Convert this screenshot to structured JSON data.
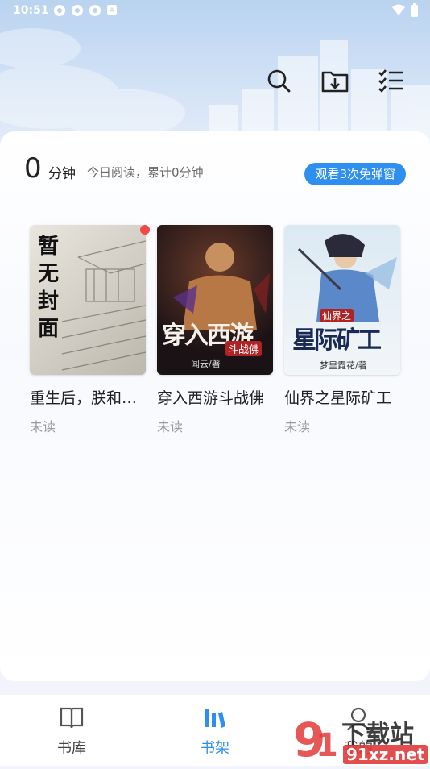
{
  "status_bar": {
    "time": "10:51"
  },
  "toolbar": {
    "search_icon": "search-icon",
    "download_icon": "download-folder-icon",
    "manage_icon": "checklist-icon"
  },
  "reading": {
    "minutes": "0",
    "unit": "分钟",
    "summary": "今日阅读，累计0分钟",
    "promo_button": "观看3次免弹窗"
  },
  "books": [
    {
      "title": "重生后，朕和…",
      "status": "未读",
      "cover_text": [
        "暂",
        "无",
        "封",
        "面"
      ],
      "has_update": true
    },
    {
      "title": "穿入西游斗战佛",
      "status": "未读",
      "cover_text": "穿入西游",
      "cover_sub": "斗战佛",
      "cover_author": "闻云/著"
    },
    {
      "title": "仙界之星际矿工",
      "status": "未读",
      "cover_text": "星际矿工",
      "cover_sub": "仙界之",
      "cover_author": "梦里霓花/著"
    }
  ],
  "nav": {
    "items": [
      {
        "label": "书库",
        "icon": "open-book-icon"
      },
      {
        "label": "书架",
        "icon": "bookshelf-icon",
        "active": true
      },
      {
        "label": "我的",
        "icon": "profile-icon"
      }
    ]
  },
  "watermark": {
    "brand": "下载站",
    "domain": "91xz.net"
  },
  "colors": {
    "accent": "#2f8ff0",
    "badge": "#f04848",
    "muted": "#9a9a9a"
  }
}
